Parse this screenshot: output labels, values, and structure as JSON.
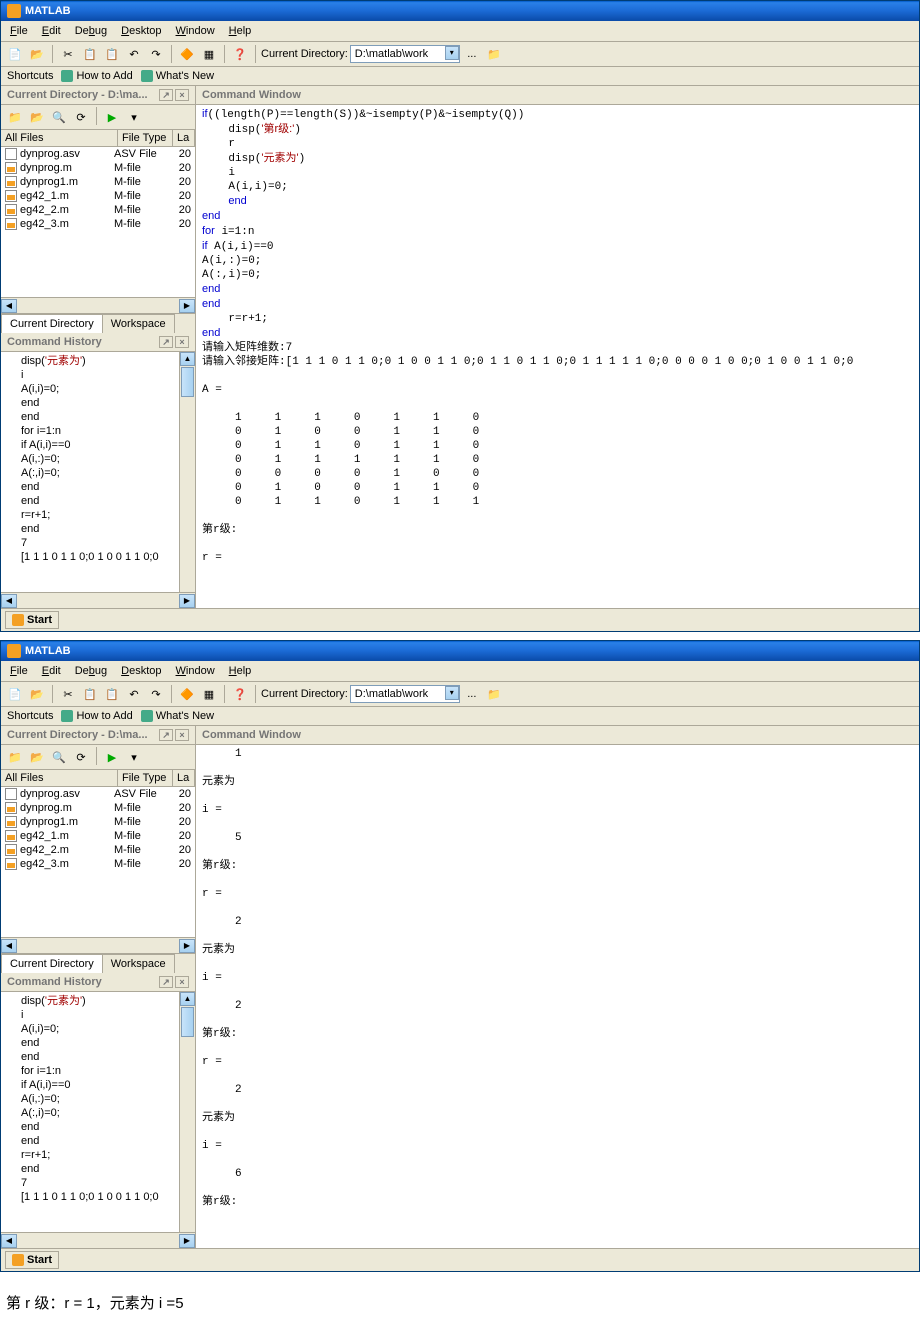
{
  "app_title": "MATLAB",
  "menu": {
    "file": "File",
    "edit": "Edit",
    "debug": "Debug",
    "desktop": "Desktop",
    "window": "Window",
    "help": "Help"
  },
  "toolbar": {
    "curdir_label": "Current Directory:",
    "curdir_value": "D:\\matlab\\work",
    "ellipsis": "...",
    "up": "⇧"
  },
  "shortcuts": {
    "label": "Shortcuts",
    "howto": "How to Add",
    "whatsnew": "What's New"
  },
  "curdir_panel": {
    "title": "Current Directory - D:\\ma...",
    "col_name": "All Files",
    "col_type": "File Type",
    "col_la": "La"
  },
  "files": [
    {
      "name": "dynprog.asv",
      "type": "ASV File",
      "la": "20",
      "icon": "asv"
    },
    {
      "name": "dynprog.m",
      "type": "M-file",
      "la": "20",
      "icon": "m"
    },
    {
      "name": "dynprog1.m",
      "type": "M-file",
      "la": "20",
      "icon": "m"
    },
    {
      "name": "eg42_1.m",
      "type": "M-file",
      "la": "20",
      "icon": "m"
    },
    {
      "name": "eg42_2.m",
      "type": "M-file",
      "la": "20",
      "icon": "m"
    },
    {
      "name": "eg42_3.m",
      "type": "M-file",
      "la": "20",
      "icon": "m"
    }
  ],
  "tabs": {
    "curdir": "Current Directory",
    "workspace": "Workspace"
  },
  "history_panel_title": "Command History",
  "history1": [
    "disp('元素为')",
    "i",
    "A(i,i)=0;",
    "end",
    "end",
    "for i=1:n",
    "if A(i,i)==0",
    "A(i,:)=0;",
    "A(:,i)=0;",
    "end",
    "end",
    "r=r+1;",
    "end",
    "7",
    "[1 1 1 0 1 1 0;0 1 0 0 1 1 0;0"
  ],
  "cmdwin_title": "Command Window",
  "cmd1_top": [
    "if((length(P)==length(S))&~isempty(P)&~isempty(Q))",
    "    disp('第r级:')",
    "    r",
    "    disp('元素为')",
    "    i",
    "    A(i,i)=0;",
    "    end",
    "end",
    "for i=1:n",
    "if A(i,i)==0",
    "A(i,:)=0;",
    "A(:,i)=0;",
    "end",
    "end",
    "    r=r+1;",
    "end"
  ],
  "cmd1_prompt1": "请输入矩阵维数:7",
  "cmd1_prompt2": "请输入邻接矩阵:[1 1 1 0 1 1 0;0 1 0 0 1 1 0;0 1 1 0 1 1 0;0 1 1 1 1 1 0;0 0 0 0 1 0 0;0 1 0 0 1 1 0;0",
  "cmd1_Alabel": "A =",
  "matrix": [
    "     1     1     1     0     1     1     0",
    "     0     1     0     0     1     1     0",
    "     0     1     1     0     1     1     0",
    "     0     1     1     1     1     1     0",
    "     0     0     0     0     1     0     0",
    "     0     1     0     0     1     1     0",
    "     0     1     1     0     1     1     1"
  ],
  "cmd1_rlevel": "第r级:",
  "cmd1_req": "r =",
  "cmd2": [
    "     1",
    "",
    "元素为",
    "",
    "i =",
    "",
    "     5",
    "",
    "第r级:",
    "",
    "r =",
    "",
    "     2",
    "",
    "元素为",
    "",
    "i =",
    "",
    "     2",
    "",
    "第r级:",
    "",
    "r =",
    "",
    "     2",
    "",
    "元素为",
    "",
    "i =",
    "",
    "     6",
    "",
    "第r级:"
  ],
  "history2": [
    "disp('元素为')",
    "i",
    "A(i,i)=0;",
    "end",
    "end",
    "for i=1:n",
    "if A(i,i)==0",
    "A(i,:)=0;",
    "A(:,i)=0;",
    "end",
    "end",
    "r=r+1;",
    "end",
    "7",
    "[1 1 1 0 1 1 0;0 1 0 0 1 1 0;0"
  ],
  "start": "Start",
  "caption": "第 r 级：r = 1，元素为 i =5"
}
